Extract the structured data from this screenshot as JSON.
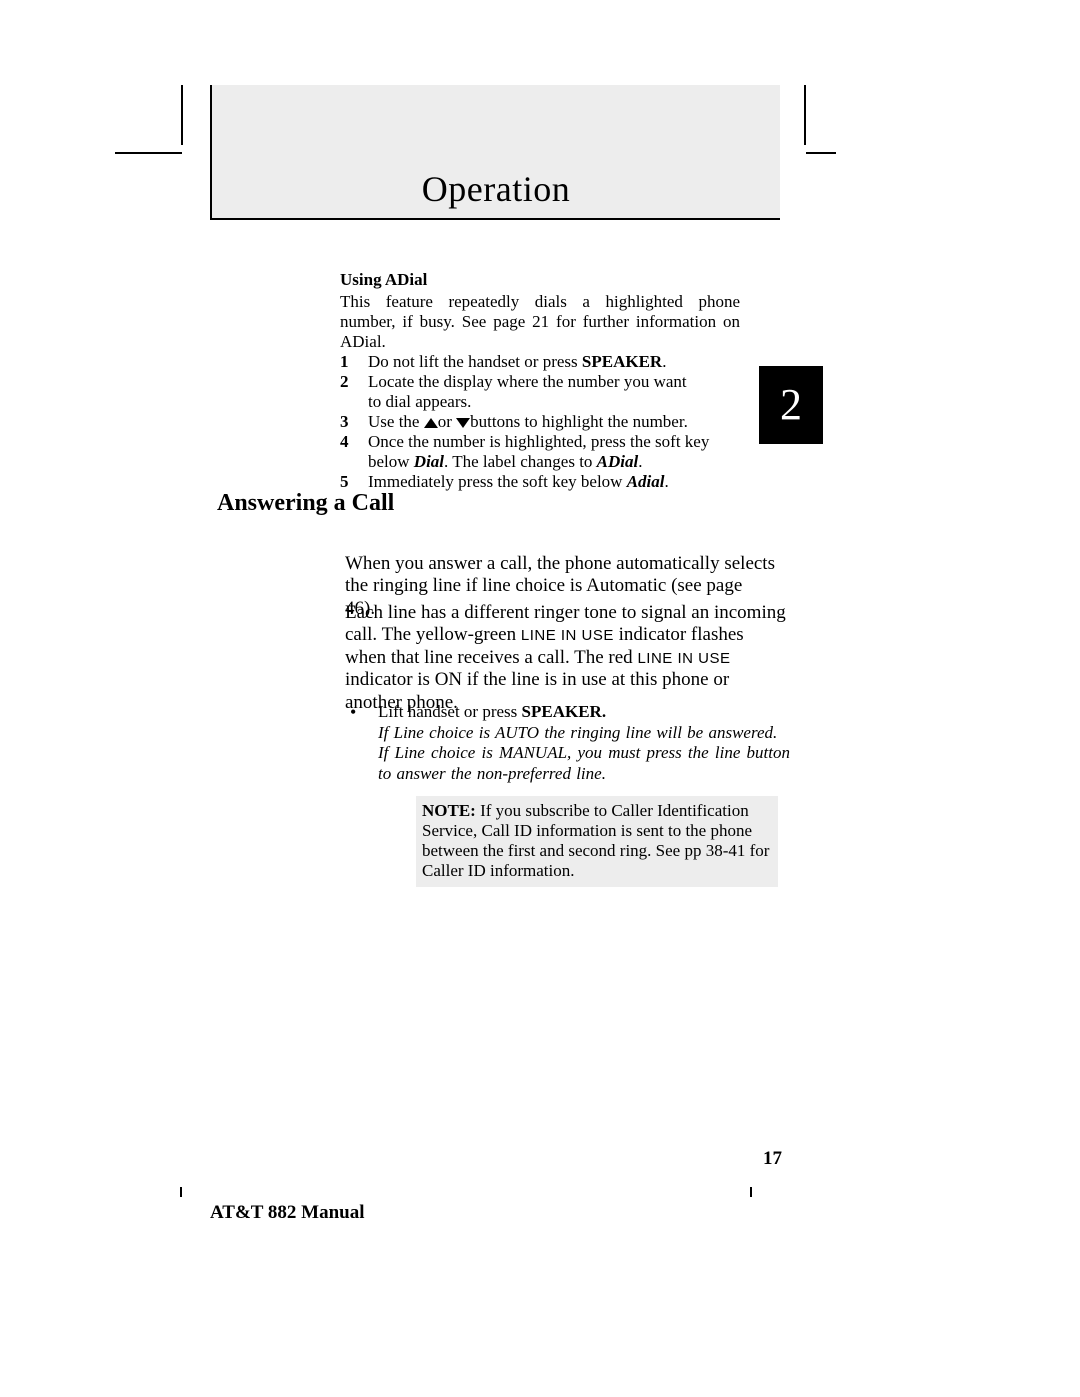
{
  "header": {
    "title": "Operation"
  },
  "chapter_tab": "2",
  "adial": {
    "heading": "Using ADial",
    "intro": "This feature repeatedly dials a highlighted phone number, if busy.  See page 21 for further information on ADial.",
    "steps": {
      "n1": "1",
      "s1a": "Do not lift the handset or press ",
      "s1b": "SPEAKER",
      "s1c": ".",
      "n2": "2",
      "s2a": "Locate the display where the number you want",
      "s2b": "to dial appears.",
      "n3": "3",
      "s3a": "Use the  ",
      "s3b": "or  ",
      "s3c": "buttons to highlight the number.",
      "n4": "4",
      "s4a": "Once the number is highlighted, press the soft key  below ",
      "s4b": "Dial",
      "s4c": ".  The label changes to ",
      "s4d": "ADial",
      "s4e": ".",
      "n5": "5",
      "s5a": "Immediately press the soft key below ",
      "s5b": "Adial",
      "s5c": "."
    }
  },
  "section_heading": "Answering a Call",
  "answer": {
    "p1": "When you answer a call, the phone automatically selects the ringing line if line choice is Automatic (see page 46).",
    "p2a": "Each line has a different ringer tone to signal an incoming call. The yellow-green ",
    "p2b": "LINE IN USE",
    "p2c": " indicator flashes when that line receives a call.  The red ",
    "p2d": "LINE IN USE",
    "p2e": " indicator is ON if the line is in use at this phone or another phone."
  },
  "bullet": {
    "lead_a": "Lift handset or press ",
    "lead_b": "SPEAKER.",
    "it1": "If Line choice is AUTO the ringing line will be answered.",
    "it2": "If Line choice is MANUAL, you must press the line button to answer the non-preferred line."
  },
  "note": {
    "label": "NOTE:",
    "text": " If you subscribe to Caller Identification Service, Call ID information is sent to the phone between the first and second ring.  See pp 38-41 for Caller ID information."
  },
  "footer": {
    "page": "17",
    "title": "AT&T 882 Manual"
  }
}
